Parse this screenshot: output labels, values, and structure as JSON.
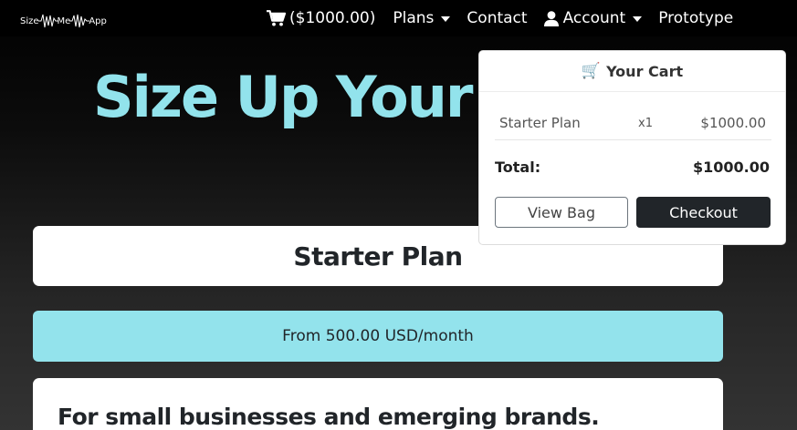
{
  "navbar": {
    "brand": {
      "part1": "Size",
      "part2": "Me",
      "part3": "App"
    },
    "cart_label": "($1000.00)",
    "plans_label": "Plans",
    "contact_label": "Contact",
    "account_label": "Account",
    "prototype_label": "Prototype"
  },
  "hero": {
    "title": "Size Up Your Bu"
  },
  "plan": {
    "title": "Starter Plan",
    "price": "From 500.00 USD/month",
    "description": "For small businesses and emerging brands."
  },
  "cart": {
    "header_icon": "🛒",
    "header": "Your Cart",
    "items": [
      {
        "name": "Starter Plan",
        "qty": "x1",
        "price": "$1000.00"
      }
    ],
    "total_label": "Total:",
    "total_value": "$1000.00",
    "view_bag_label": "View Bag",
    "checkout_label": "Checkout"
  },
  "colors": {
    "accent": "#92e3ec",
    "dark_button": "#212529"
  }
}
